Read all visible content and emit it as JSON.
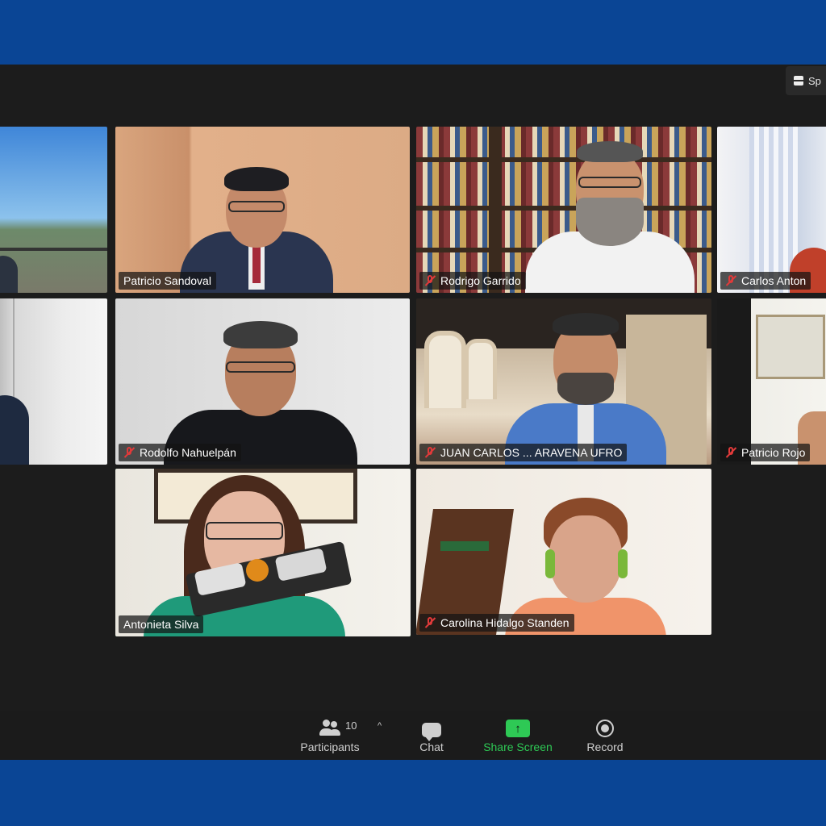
{
  "view_button": {
    "label": "Sp"
  },
  "tiles": {
    "patricio_sandoval": "Patricio Sandoval",
    "rodrigo_garrido": "Rodrigo Garrido",
    "carlos_anton": "Carlos Anton",
    "rodolfo_nahuelpan": "Rodolfo Nahuelpán",
    "juan_carlos": "JUAN CARLOS ... ARAVENA UFRO",
    "patricio_rojo": "Patricio Rojo",
    "antonieta_silva": "Antonieta Silva",
    "carolina_hidalgo": "Carolina Hidalgo Standen"
  },
  "toolbar": {
    "participants_label": "Participants",
    "participants_count": "10",
    "chat_label": "Chat",
    "share_label": "Share Screen",
    "share_arrow": "↑",
    "record_label": "Record",
    "caret": "^"
  },
  "colors": {
    "brand_band": "#0a4595",
    "active_speaker": "#2ec955",
    "muted": "#e03a3a"
  }
}
